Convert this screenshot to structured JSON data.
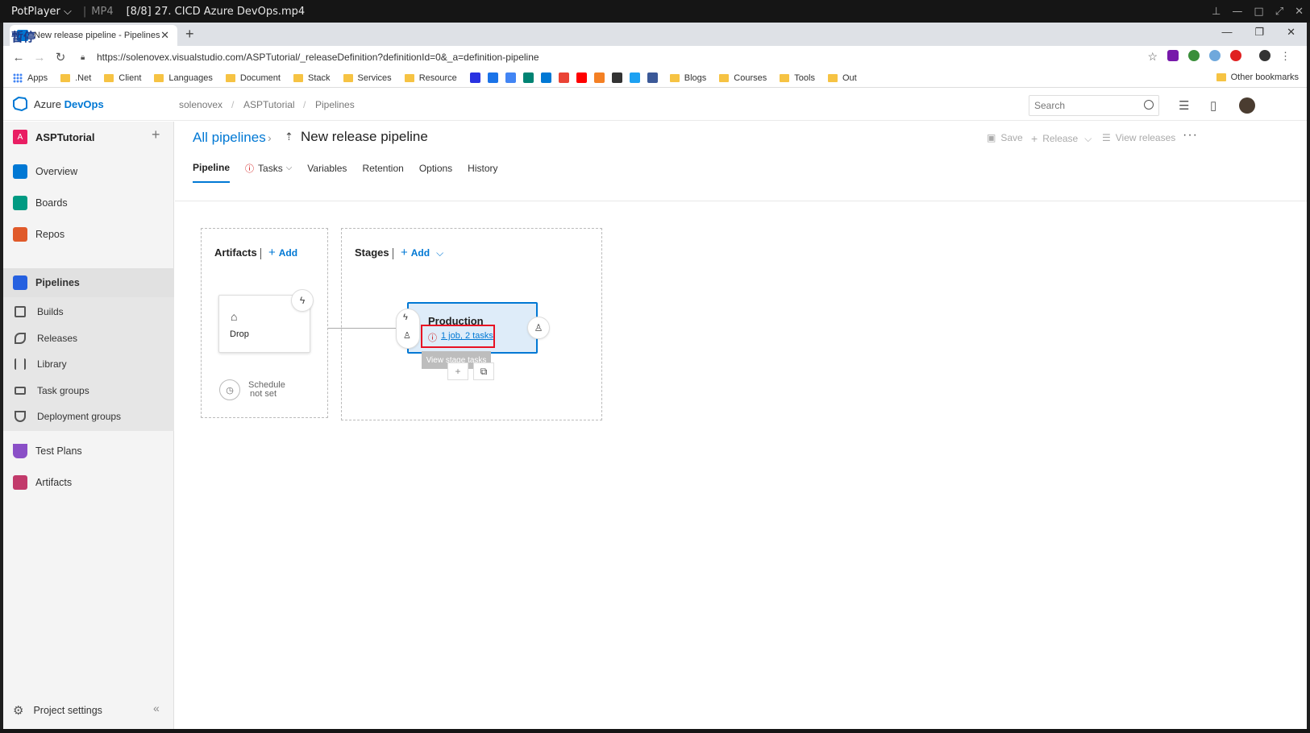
{
  "player": {
    "app": "PotPlayer",
    "format": "MP4",
    "file_title": "[8/8] 27. CICD Azure DevOps.mp4"
  },
  "browser": {
    "tab_title": "New release pipeline - Pipelines",
    "overlay_text": "暫停",
    "url": "https://solenovex.visualstudio.com/ASPTutorial/_releaseDefinition?definitionId=0&_a=definition-pipeline",
    "bookmarks": [
      {
        "label": "Apps",
        "kind": "apps"
      },
      {
        "label": ".Net",
        "kind": "folder"
      },
      {
        "label": "Client",
        "kind": "folder"
      },
      {
        "label": "Languages",
        "kind": "folder"
      },
      {
        "label": "Document",
        "kind": "folder"
      },
      {
        "label": "Stack",
        "kind": "folder"
      },
      {
        "label": "Services",
        "kind": "folder"
      },
      {
        "label": "Resource",
        "kind": "folder"
      }
    ],
    "bookmark_icons": [
      {
        "name": "baidu-icon",
        "color": "#2932e1"
      },
      {
        "name": "trans-icon",
        "color": "#1a73e8"
      },
      {
        "name": "translate-icon",
        "color": "#4285f4"
      },
      {
        "name": "bing-icon",
        "color": "#008373"
      },
      {
        "name": "azure-icon",
        "color": "#0078d4"
      },
      {
        "name": "google-icon",
        "color": "#ea4335"
      },
      {
        "name": "youtube-icon",
        "color": "#ff0000"
      },
      {
        "name": "stackoverflow-icon",
        "color": "#f48024"
      },
      {
        "name": "wikipedia-icon",
        "color": "#333333"
      },
      {
        "name": "twitter-icon",
        "color": "#1da1f2"
      },
      {
        "name": "facebook-icon",
        "color": "#3b5998"
      }
    ],
    "bookmarks_tail": [
      {
        "label": "Blogs"
      },
      {
        "label": "Courses"
      },
      {
        "label": "Tools"
      },
      {
        "label": "Out"
      }
    ],
    "other_bookmarks": "Other bookmarks"
  },
  "ado": {
    "brand_prefix": "Azure ",
    "brand_suffix": "DevOps",
    "breadcrumb": [
      "solenovex",
      "/",
      "ASPTutorial",
      "/",
      "Pipelines"
    ],
    "search_placeholder": "Search",
    "project": {
      "badge": "A",
      "name": "ASPTutorial"
    },
    "nav": {
      "overview": "Overview",
      "boards": "Boards",
      "repos": "Repos",
      "pipelines": "Pipelines",
      "builds": "Builds",
      "releases": "Releases",
      "library": "Library",
      "task_groups": "Task groups",
      "deployment_groups": "Deployment groups",
      "test_plans": "Test Plans",
      "artifacts": "Artifacts",
      "project_settings": "Project settings"
    },
    "colors": {
      "accent": "#0078d4",
      "error": "#e81123"
    }
  },
  "main": {
    "all_pipelines": "All pipelines",
    "title": "New release pipeline",
    "actions": {
      "save": "Save",
      "release": "Release",
      "view_releases": "View releases"
    },
    "tabs": {
      "pipeline": "Pipeline",
      "tasks": "Tasks",
      "variables": "Variables",
      "retention": "Retention",
      "options": "Options",
      "history": "History"
    },
    "artifacts": {
      "title": "Artifacts",
      "add": "Add",
      "card": "Drop",
      "schedule_line1": "Schedule",
      "schedule_line2": "not set"
    },
    "stages": {
      "title": "Stages",
      "add": "Add",
      "stage_name": "Production",
      "stage_link": "1 job, 2 tasks",
      "tooltip": "View stage tasks"
    }
  }
}
